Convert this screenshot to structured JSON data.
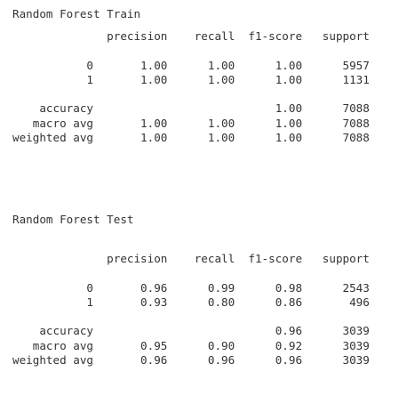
{
  "train": {
    "title": "Random Forest Train",
    "report": "              precision    recall  f1-score   support\n\n           0       1.00      1.00      1.00      5957\n           1       1.00      1.00      1.00      1131\n\n    accuracy                           1.00      7088\n   macro avg       1.00      1.00      1.00      7088\nweighted avg       1.00      1.00      1.00      7088"
  },
  "test": {
    "title": "Random Forest Test",
    "report": "              precision    recall  f1-score   support\n\n           0       0.96      0.99      0.98      2543\n           1       0.93      0.80      0.86       496\n\n    accuracy                           0.96      3039\n   macro avg       0.95      0.90      0.92      3039\nweighted avg       0.96      0.96      0.96      3039"
  }
}
